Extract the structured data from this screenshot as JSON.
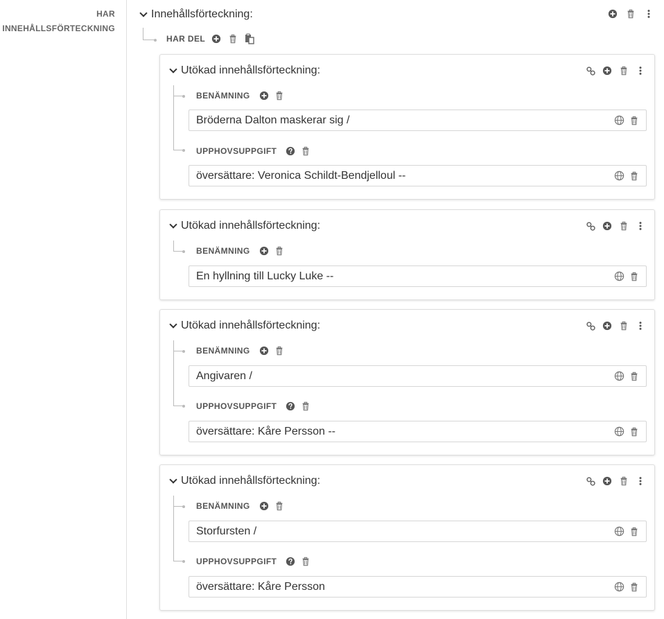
{
  "left": {
    "label_line1": "HAR",
    "label_line2": "INNEHÅLLSFÖRTECKNING"
  },
  "root": {
    "title": "Innehållsförteckning:",
    "has_part_label": "HAR DEL"
  },
  "cards": [
    {
      "title": "Utökad innehållsförteckning:",
      "name_label": "BENÄMNING",
      "name_value": "Bröderna Dalton maskerar sig /",
      "resp_label": "UPPHOVSUPPGIFT",
      "resp_value": "översättare: Veronica Schildt-Bendjelloul --"
    },
    {
      "title": "Utökad innehållsförteckning:",
      "name_label": "BENÄMNING",
      "name_value": "En hyllning till Lucky Luke --"
    },
    {
      "title": "Utökad innehållsförteckning:",
      "name_label": "BENÄMNING",
      "name_value": "Angivaren /",
      "resp_label": "UPPHOVSUPPGIFT",
      "resp_value": "översättare: Kåre Persson --"
    },
    {
      "title": "Utökad innehållsförteckning:",
      "name_label": "BENÄMNING",
      "name_value": "Storfursten /",
      "resp_label": "UPPHOVSUPPGIFT",
      "resp_value": "översättare: Kåre Persson"
    }
  ],
  "icons": {
    "add": "plus-circle-icon",
    "delete": "trash-icon",
    "menu": "kebab-menu-icon",
    "link": "link-icon",
    "paste": "paste-icon",
    "help": "question-circle-icon",
    "language": "globe-icon",
    "collapse": "chevron-down-icon"
  },
  "colors": {
    "icon": "#555555",
    "icon_light": "#888888",
    "connector": "#bbbbbb",
    "border": "#dedede"
  }
}
